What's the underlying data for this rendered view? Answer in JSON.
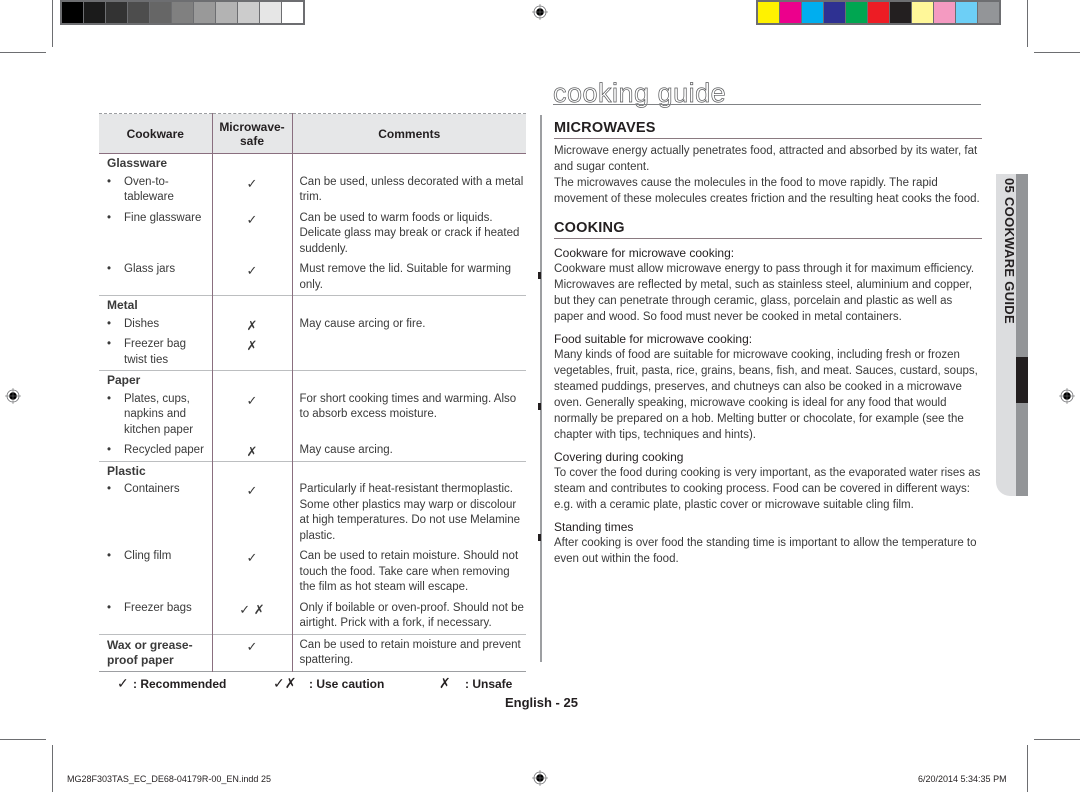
{
  "color_bars": {
    "grayscale": [
      "#000000",
      "#1b1b1b",
      "#333333",
      "#4d4d4d",
      "#666666",
      "#808080",
      "#999999",
      "#b3b3b3",
      "#cccccc",
      "#e6e6e6",
      "#ffffff"
    ],
    "process": [
      "#fff200",
      "#ec008c",
      "#00aeef",
      "#2e3192",
      "#00a651",
      "#ed1c24",
      "#231f20",
      "#fff799",
      "#f49ac1",
      "#6dcff6",
      "#939598"
    ]
  },
  "page": {
    "title": "cooking guide",
    "side_tab": "05  COOKWARE GUIDE",
    "page_label": "English - 25",
    "footer_file": "MG28F303TAS_EC_DE68-04179R-00_EN.indd   25",
    "footer_date": "6/20/2014   5:34:35 PM"
  },
  "table": {
    "headers": {
      "cookware": "Cookware",
      "safe_line1": "Microwave-",
      "safe_line2": "safe",
      "comments": "Comments"
    },
    "groups": [
      {
        "category": "Glassware",
        "items": [
          {
            "name": "Oven-to-tableware",
            "safe": "✓",
            "comment": "Can be used, unless decorated with a metal trim."
          },
          {
            "name": "Fine glassware",
            "safe": "✓",
            "comment": "Can be used to warm foods or liquids. Delicate glass may break or crack if heated suddenly."
          },
          {
            "name": "Glass jars",
            "safe": "✓",
            "comment": "Must remove the lid. Suitable for warming only."
          }
        ]
      },
      {
        "category": "Metal",
        "items": [
          {
            "name": "Dishes",
            "safe": "✗",
            "comment": "May cause arcing or fire."
          },
          {
            "name": "Freezer bag twist ties",
            "safe": "✗",
            "comment": ""
          }
        ]
      },
      {
        "category": "Paper",
        "items": [
          {
            "name": "Plates, cups, napkins and kitchen paper",
            "safe": "✓",
            "comment": "For short cooking times and warming. Also to absorb excess moisture."
          },
          {
            "name": "Recycled paper",
            "safe": "✗",
            "comment": "May cause arcing."
          }
        ]
      },
      {
        "category": "Plastic",
        "items": [
          {
            "name": "Containers",
            "safe": "✓",
            "comment": "Particularly if heat-resistant thermoplastic. Some other plastics may warp or discolour at high temperatures. Do not use Melamine plastic."
          },
          {
            "name": "Cling film",
            "safe": "✓",
            "comment": "Can be used to retain moisture. Should not touch the food. Take care when removing the film as hot steam will escape."
          },
          {
            "name": "Freezer bags",
            "safe": "✓ ✗",
            "comment": "Only if boilable or oven-proof. Should not be airtight. Prick with a fork, if necessary."
          }
        ]
      }
    ],
    "wax_row": {
      "name": "Wax or grease-proof paper",
      "safe": "✓",
      "comment": "Can be used to retain moisture and prevent spattering."
    }
  },
  "legend": [
    {
      "symbol": "✓",
      "label": ": Recommended"
    },
    {
      "symbol": "✓✗",
      "label": ": Use caution"
    },
    {
      "symbol": "✗",
      "label": ": Unsafe"
    }
  ],
  "microwaves": {
    "heading": "MICROWAVES",
    "p1": "Microwave energy actually penetrates food, attracted and absorbed by its water, fat and sugar content.",
    "p2": "The microwaves cause the molecules in the food to move rapidly. The rapid movement of these molecules creates friction and the resulting heat cooks the food."
  },
  "cooking": {
    "heading": "COOKING",
    "sections": [
      {
        "title": "Cookware for microwave cooking:",
        "body": "Cookware must allow microwave energy to pass through it for maximum efficiency. Microwaves are reflected by metal, such as stainless steel, aluminium and copper, but they can penetrate through ceramic, glass, porcelain and plastic as well as paper and wood. So food must never be cooked in metal containers."
      },
      {
        "title": "Food suitable for microwave cooking:",
        "body": "Many kinds of food are suitable for microwave cooking, including fresh or frozen vegetables, fruit, pasta, rice, grains, beans, fish, and meat. Sauces, custard, soups, steamed puddings, preserves, and chutneys can also be cooked in a microwave oven. Generally speaking, microwave cooking is ideal for any food that would normally be prepared on a hob. Melting butter or chocolate, for example (see the chapter with tips, techniques and hints)."
      },
      {
        "title": "Covering during cooking",
        "body": "To cover the food during cooking is very important, as the evaporated water rises as steam and contributes to cooking process. Food can be covered in different ways: e.g. with a ceramic plate, plastic cover or microwave suitable cling film."
      },
      {
        "title": "Standing times",
        "body": "After cooking is over food the standing time is important to allow the temperature to even out within the food."
      }
    ]
  }
}
